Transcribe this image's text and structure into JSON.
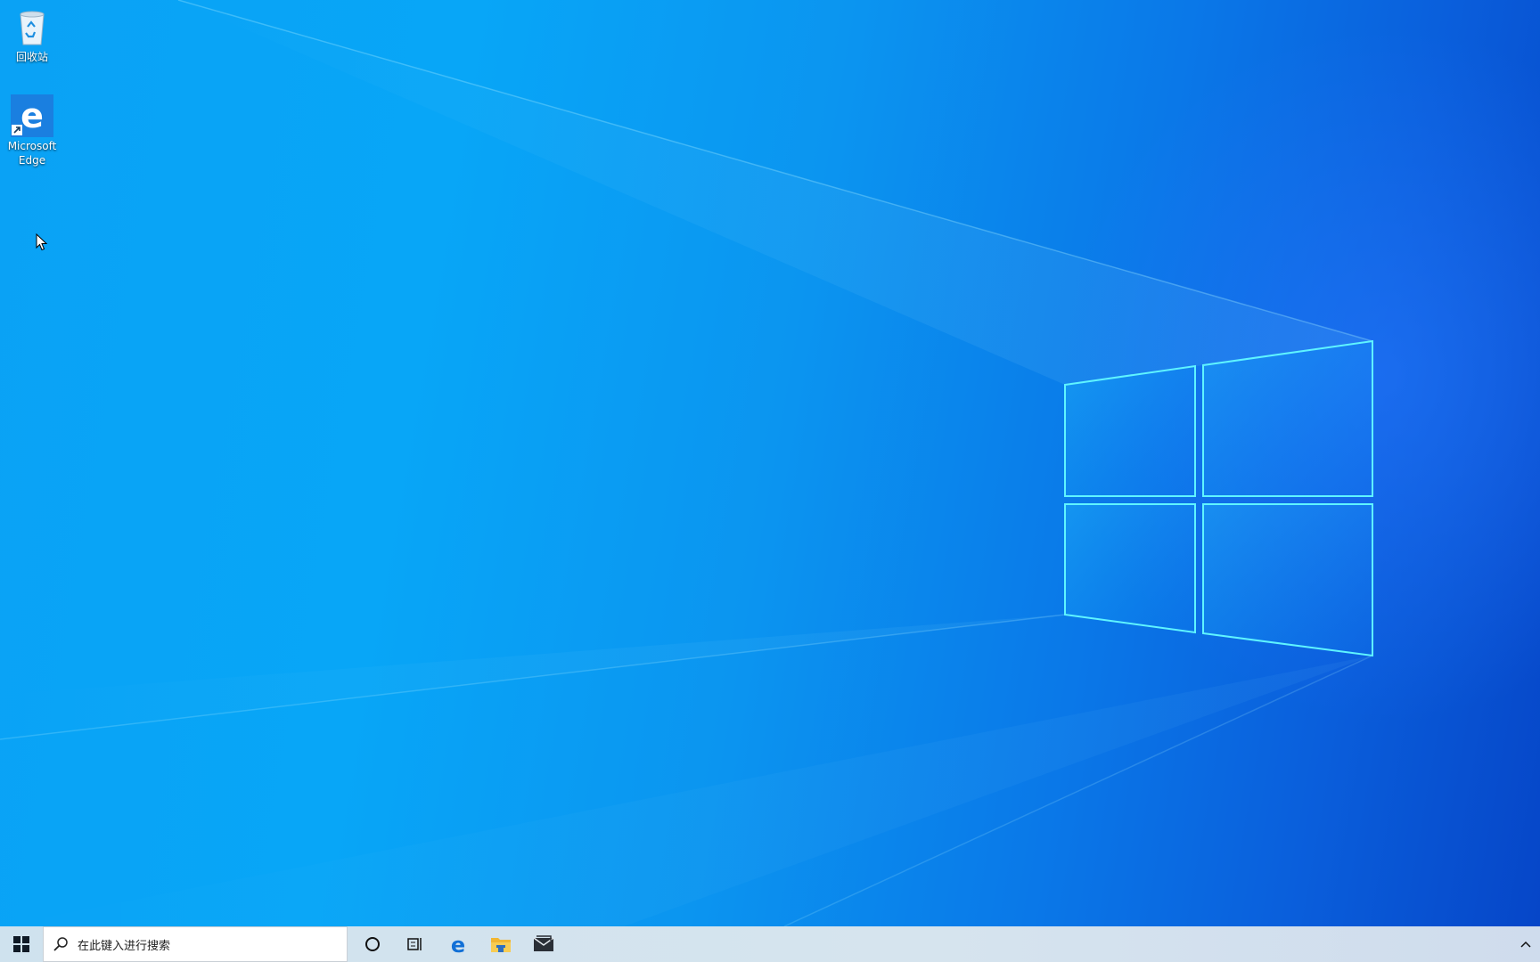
{
  "desktop": {
    "icons": [
      {
        "label": "回收站",
        "icon": "recycle-bin-icon"
      },
      {
        "label": "Microsoft Edge",
        "icon": "edge-icon"
      }
    ]
  },
  "taskbar": {
    "start_icon": "windows-logo-icon",
    "search_placeholder": "在此键入进行搜索",
    "pinned": [
      "cortana-icon",
      "task-view-icon",
      "edge-icon",
      "file-explorer-icon",
      "mail-icon"
    ],
    "tray": [
      "chevron-up-icon"
    ]
  },
  "colors": {
    "accent": "#0a78e8",
    "taskbar_bg": "#d6e4ee",
    "edge_blue": "#0f6fd1"
  }
}
